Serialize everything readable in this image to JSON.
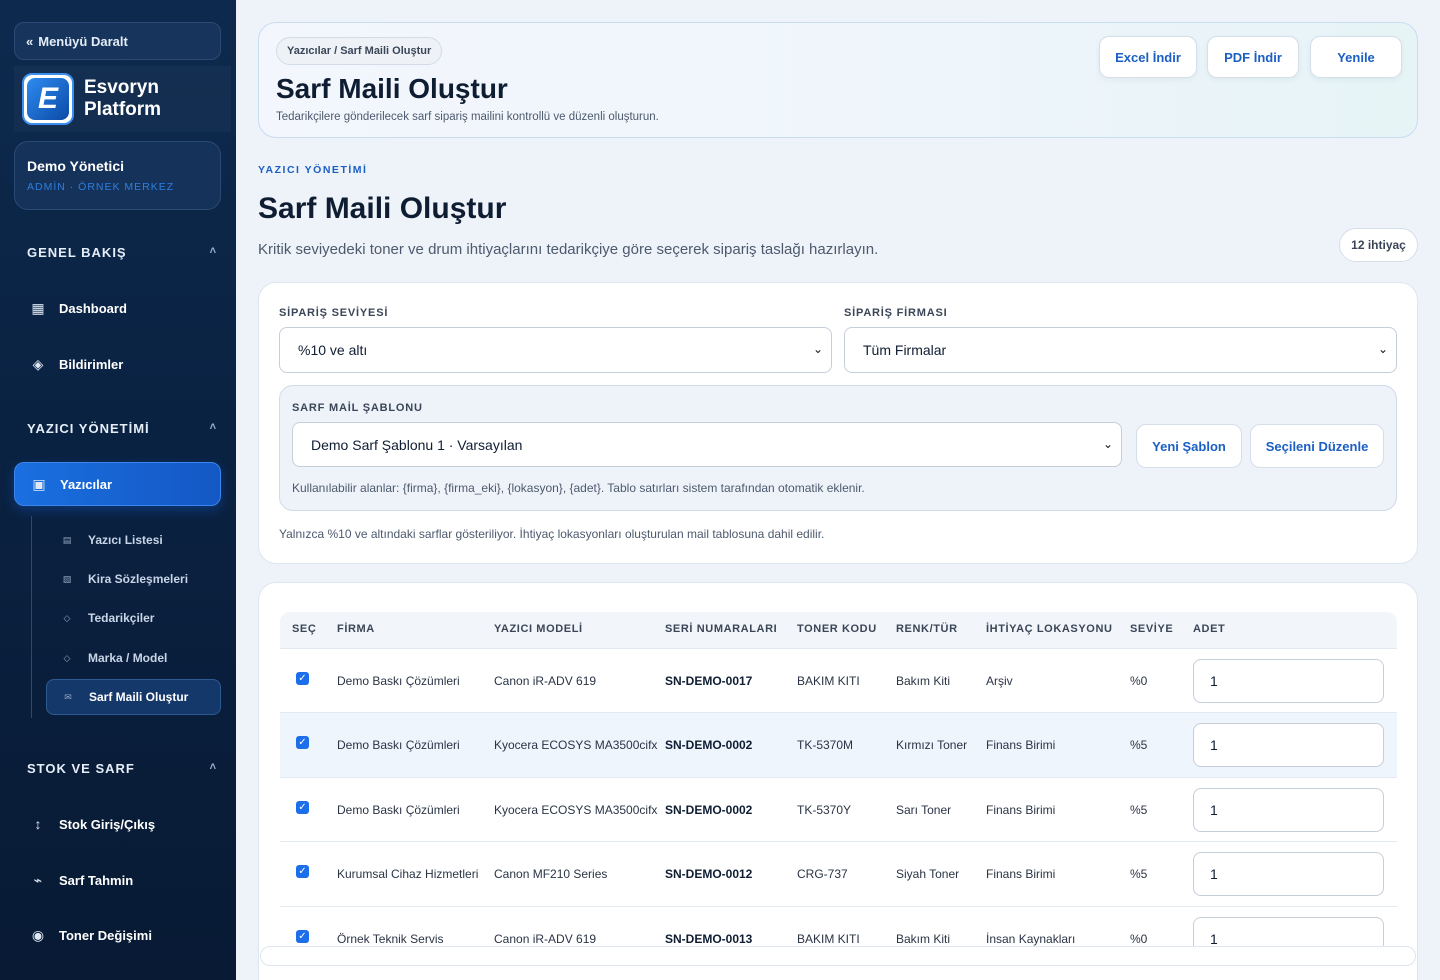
{
  "sidebar": {
    "collapse_label": "Menüyü Daralt",
    "brand_line1": "Esvoryn",
    "brand_line2": "Platform",
    "user_name": "Demo Yönetici",
    "user_role": "ADMİN · ÖRNEK MERKEZ",
    "sections": {
      "general": "GENEL BAKIŞ",
      "printer": "YAZICI YÖNETİMİ",
      "stock": "STOK VE SARF"
    },
    "items": {
      "dashboard": "Dashboard",
      "notifications": "Bildirimler",
      "printers": "Yazıcılar",
      "stock_io": "Stok Giriş/Çıkış",
      "consumable_forecast": "Sarf Tahmin",
      "toner_change": "Toner Değişimi"
    },
    "subitems": {
      "printer_list": "Yazıcı Listesi",
      "lease": "Kira Sözleşmeleri",
      "suppliers": "Tedarikçiler",
      "brand_model": "Marka / Model",
      "consumable_mail": "Sarf Maili Oluştur"
    }
  },
  "hero": {
    "breadcrumb": "Yazıcılar / Sarf Maili Oluştur",
    "title": "Sarf Maili Oluştur",
    "subtitle": "Tedarikçilere gönderilecek sarf sipariş mailini kontrollü ve düzenli oluşturun.",
    "excel_label": "Excel İndir",
    "pdf_label": "PDF İndir",
    "refresh_label": "Yenile"
  },
  "page": {
    "eyebrow": "YAZICI YÖNETİMİ",
    "title": "Sarf Maili Oluştur",
    "subtitle": "Kritik seviyedeki toner ve drum ihtiyaçlarını tedarikçiye göre seçerek sipariş taslağı hazırlayın.",
    "need_count": "12 ihtiyaç"
  },
  "filters": {
    "level_label": "SİPARİŞ SEVİYESİ",
    "level_value": "%10 ve altı",
    "company_label": "SİPARİŞ FİRMASI",
    "company_value": "Tüm Firmalar",
    "template_label": "SARF MAİL ŞABLONU",
    "template_value": "Demo Sarf Şablonu 1 · Varsayılan",
    "new_template_label": "Yeni Şablon",
    "edit_selected_label": "Seçileni Düzenle",
    "template_help": "Kullanılabilir alanlar: {firma}, {firma_eki}, {lokasyon}, {adet}. Tablo satırları sistem tarafından otomatik eklenir.",
    "note": "Yalnızca %10 ve altındaki sarflar gösteriliyor. İhtiyaç lokasyonları oluşturulan mail tablosuna dahil edilir."
  },
  "table": {
    "headers": [
      "SEÇ",
      "FİRMA",
      "YAZICI MODELİ",
      "SERİ NUMARALARI",
      "TONER KODU",
      "RENK/TÜR",
      "İHTİYAÇ LOKASYONU",
      "SEVİYE",
      "ADET"
    ],
    "rows": [
      {
        "company": "Demo Baskı Çözümleri",
        "model": "Canon iR-ADV 619",
        "serial": "SN-DEMO-0017",
        "toner": "BAKIM KITI",
        "type": "Bakım Kiti",
        "location": "Arşiv",
        "level": "%0",
        "qty": "1"
      },
      {
        "company": "Demo Baskı Çözümleri",
        "model": "Kyocera ECOSYS MA3500cifx",
        "serial": "SN-DEMO-0002",
        "toner": "TK-5370M",
        "type": "Kırmızı Toner",
        "location": "Finans Birimi",
        "level": "%5",
        "qty": "1"
      },
      {
        "company": "Demo Baskı Çözümleri",
        "model": "Kyocera ECOSYS MA3500cifx",
        "serial": "SN-DEMO-0002",
        "toner": "TK-5370Y",
        "type": "Sarı Toner",
        "location": "Finans Birimi",
        "level": "%5",
        "qty": "1"
      },
      {
        "company": "Kurumsal Cihaz Hizmetleri",
        "model": "Canon MF210 Series",
        "serial": "SN-DEMO-0012",
        "toner": "CRG-737",
        "type": "Siyah Toner",
        "location": "Finans Birimi",
        "level": "%5",
        "qty": "1"
      },
      {
        "company": "Örnek Teknik Servis",
        "model": "Canon iR-ADV 619",
        "serial": "SN-DEMO-0013",
        "toner": "BAKIM KITI",
        "type": "Bakım Kiti",
        "location": "İnsan Kaynakları",
        "level": "%0",
        "qty": "1"
      }
    ]
  },
  "icons": {
    "collapse": "double-chevron-left-icon",
    "dashboard": "grid-icon",
    "notifications": "diamond-icon",
    "printers": "printer-icon",
    "stock_io": "up-down-arrow-icon",
    "forecast": "trend-icon",
    "toner": "circle-icon"
  },
  "colors": {
    "accent": "#1b5fc4",
    "sidebar_bg": "#0a2140",
    "active_nav": "#1a6fe0"
  }
}
